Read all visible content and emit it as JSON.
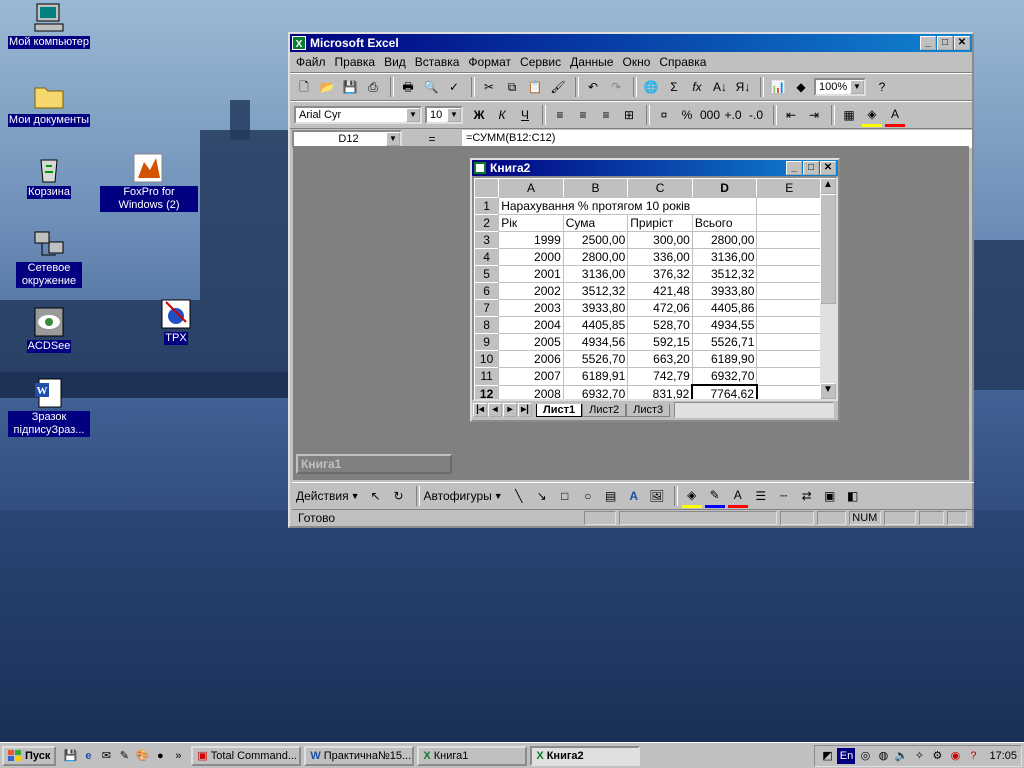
{
  "desktop": {
    "icons": [
      {
        "label": "Мой компьютер",
        "icon": "my-computer-icon"
      },
      {
        "label": "Мои документы",
        "icon": "my-documents-icon"
      },
      {
        "label": "Корзина",
        "icon": "recycle-bin-icon"
      },
      {
        "label": "FoxPro for Windows (2)",
        "icon": "foxpro-icon"
      },
      {
        "label": "Сетевое окружение",
        "icon": "network-icon"
      },
      {
        "label": "TPX",
        "icon": "tpx-icon"
      },
      {
        "label": "ACDSee",
        "icon": "acdsee-icon"
      },
      {
        "label": "Зразок підписуЗраз...",
        "icon": "word-document-icon"
      }
    ]
  },
  "excel": {
    "title": "Microsoft Excel",
    "menu": [
      "Файл",
      "Правка",
      "Вид",
      "Вставка",
      "Формат",
      "Сервис",
      "Данные",
      "Окно",
      "Справка"
    ],
    "zoom": "100%",
    "font_name": "Arial Cyr",
    "font_size": "10",
    "name_box": "D12",
    "equals": "=",
    "formula": "=СУММ(B12:C12)",
    "minimized_book": "Книга1",
    "drawing": {
      "actions": "Действия",
      "autoshapes": "Автофигуры"
    },
    "status": {
      "ready": "Готово",
      "num": "NUM"
    }
  },
  "book": {
    "title": "Книга2",
    "columns": [
      "A",
      "B",
      "C",
      "D",
      "E"
    ],
    "rows": [
      {
        "n": "1",
        "a": "Нарахування % протягом 10 років",
        "b": "",
        "c": "",
        "d": ""
      },
      {
        "n": "2",
        "a": "Рік",
        "b": "Сума",
        "c": "Приріст",
        "d": "Всього"
      },
      {
        "n": "3",
        "a": "1999",
        "b": "2500,00",
        "c": "300,00",
        "d": "2800,00"
      },
      {
        "n": "4",
        "a": "2000",
        "b": "2800,00",
        "c": "336,00",
        "d": "3136,00"
      },
      {
        "n": "5",
        "a": "2001",
        "b": "3136,00",
        "c": "376,32",
        "d": "3512,32"
      },
      {
        "n": "6",
        "a": "2002",
        "b": "3512,32",
        "c": "421,48",
        "d": "3933,80"
      },
      {
        "n": "7",
        "a": "2003",
        "b": "3933,80",
        "c": "472,06",
        "d": "4405,86"
      },
      {
        "n": "8",
        "a": "2004",
        "b": "4405,85",
        "c": "528,70",
        "d": "4934,55"
      },
      {
        "n": "9",
        "a": "2005",
        "b": "4934,56",
        "c": "592,15",
        "d": "5526,71"
      },
      {
        "n": "10",
        "a": "2006",
        "b": "5526,70",
        "c": "663,20",
        "d": "6189,90"
      },
      {
        "n": "11",
        "a": "2007",
        "b": "6189,91",
        "c": "742,79",
        "d": "6932,70"
      },
      {
        "n": "12",
        "a": "2008",
        "b": "6932,70",
        "c": "831,92",
        "d": "7764,62"
      }
    ],
    "sheets": [
      "Лист1",
      "Лист2",
      "Лист3"
    ]
  },
  "taskbar": {
    "start": "Пуск",
    "tasks": [
      "Total Command...",
      "Практична№15...",
      "Книга1",
      "Книга2"
    ],
    "lang": "En",
    "clock": "17:05"
  }
}
